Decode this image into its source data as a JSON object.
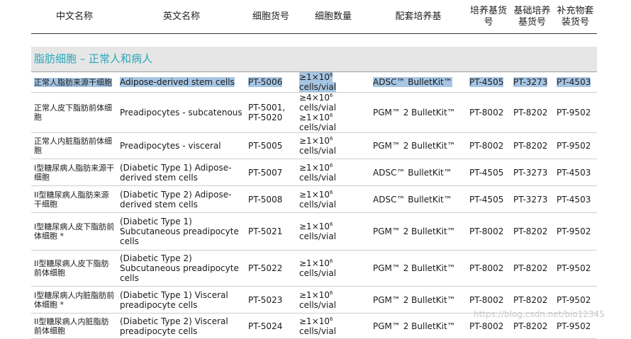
{
  "columns": [
    "中文名称",
    "英文名称",
    "细胞货号",
    "细胞数量",
    "配套培养基",
    "培养基货号",
    "基础培养基货号",
    "补充物套装货号"
  ],
  "section_title": "脂肪细胞 – 正常人和病人",
  "rows": [
    {
      "zh": "正常人脂肪来源干细胞",
      "en": "Adipose-derived stem cells",
      "cat": "PT-5006",
      "qty": "≥1×10⁶ cells/vial",
      "medium": "ADSC™ BulletKit™",
      "kit": "PT-4505",
      "basal": "PT-3273",
      "supp": "PT-4503",
      "highlighted": true
    },
    {
      "zh": "正常人皮下脂肪前体细胞",
      "en": "Preadipocytes - subcatenous",
      "cat": "PT-5001, PT-5020",
      "qty": "≥4×10⁶ cells/vial ≥1×10⁶ cells/vial",
      "medium": "PGM™ 2 BulletKit™",
      "kit": "PT-8002",
      "basal": "PT-8202",
      "supp": "PT-9502"
    },
    {
      "zh": "正常人内脏脂肪前体细胞",
      "en": "Preadipocytes - visceral",
      "cat": "PT-5005",
      "qty": "≥1×10⁶ cells/vial",
      "medium": "PGM™ 2 BulletKit™",
      "kit": "PT-8002",
      "basal": "PT-8202",
      "supp": "PT-9502"
    },
    {
      "zh": "I型糖尿病人脂肪来源干细胞",
      "en": "(Diabetic Type 1) Adipose-derived stem cells",
      "cat": "PT-5007",
      "qty": "≥1×10⁶ cells/vial",
      "medium": "ADSC™ BulletKit™",
      "kit": "PT-4505",
      "basal": "PT-3273",
      "supp": "PT-4503"
    },
    {
      "zh": "II型糖尿病人脂肪来源干细胞",
      "en": "(Diabetic Type 2) Adipose-derived stem cells",
      "cat": "PT-5008",
      "qty": "≥1×10⁶ cells/vial",
      "medium": "ADSC™ BulletKit™",
      "kit": "PT-4505",
      "basal": "PT-3273",
      "supp": "PT-4503"
    },
    {
      "zh": "I型糖尿病人皮下脂肪前体细胞 *",
      "en": "(Diabetic Type 1) Subcutaneous preadipocyte cells",
      "cat": "PT-5021",
      "qty": "≥1×10⁶ cells/vial",
      "medium": "PGM™ 2 BulletKit™",
      "kit": "PT-8002",
      "basal": "PT-8202",
      "supp": "PT-9502"
    },
    {
      "zh": "II型糖尿病人皮下脂肪前体细胞",
      "en": "(Diabetic Type 2) Subcutaneous preadipocyte cells",
      "cat": "PT-5022",
      "qty": "≥1×10⁶ cells/vial",
      "medium": "PGM™ 2 BulletKit™",
      "kit": "PT-8002",
      "basal": "PT-8202",
      "supp": "PT-9502"
    },
    {
      "zh": "I型糖尿病人内脏脂肪前体细胞 *",
      "en": "(Diabetic Type 1) Visceral preadipocyte cells",
      "cat": "PT-5023",
      "qty": "≥1×10⁶ cells/vial",
      "medium": "PGM™ 2 BulletKit™",
      "kit": "PT-8002",
      "basal": "PT-8202",
      "supp": "PT-9502"
    },
    {
      "zh": "II型糖尿病人内脏脂肪前体细胞",
      "en": "(Diabetic Type 2) Visceral preadipocyte cells",
      "cat": "PT-5024",
      "qty": "≥1×10⁶ cells/vial",
      "medium": "PGM™ 2 BulletKit™",
      "kit": "PT-8002",
      "basal": "PT-8202",
      "supp": "PT-9502"
    }
  ],
  "watermark": "https://blog.csdn.net/bio12345",
  "colors": {
    "section_title": "#2aa7b8",
    "section_band": "#e6e6e6",
    "selection": "#a7c6e4"
  }
}
